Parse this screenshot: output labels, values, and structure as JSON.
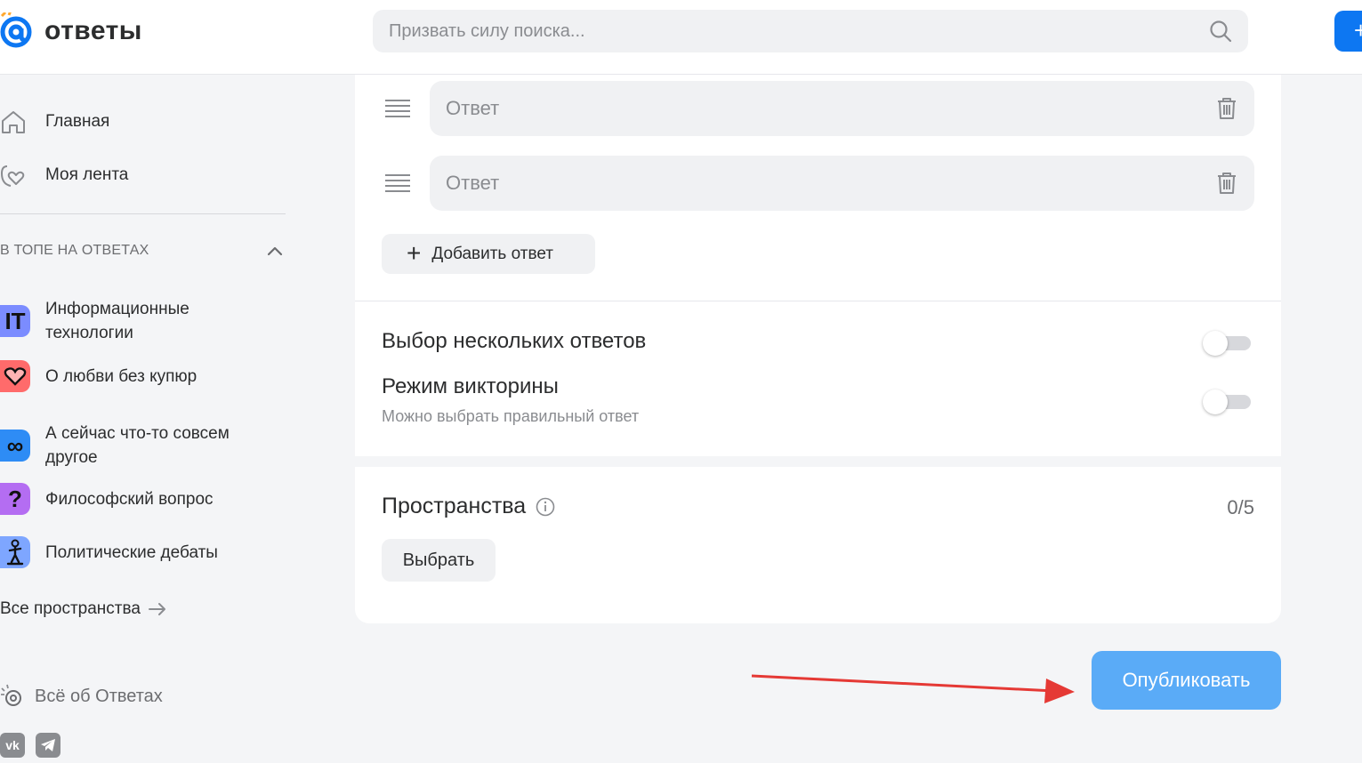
{
  "header": {
    "logo_text": "ответы",
    "search_placeholder": "Призвать силу поиска...",
    "header_button_label": "+"
  },
  "sidebar": {
    "nav": [
      {
        "label": "Главная",
        "icon": "home-icon"
      },
      {
        "label": "Моя лента",
        "icon": "feed-heart-icon"
      }
    ],
    "section_title": "В ТОПЕ НА ОТВЕТАХ",
    "topics": [
      {
        "label": "Информационные технологии",
        "badge": "IT",
        "color": "#7b8cff"
      },
      {
        "label": "О любви без купюр",
        "badge": "♡",
        "color": "#ff6b6b"
      },
      {
        "label": "А сейчас что-то совсем другое",
        "badge": "∞",
        "color": "#2e8cf5"
      },
      {
        "label": "Философский вопрос",
        "badge": "?",
        "color": "#b46df2"
      },
      {
        "label": "Политические дебаты",
        "badge": "🎤",
        "color": "#7ea6ff"
      }
    ],
    "all_spaces": "Все пространства",
    "about": "Всё об Ответах",
    "social": [
      {
        "icon": "vk-icon",
        "label": "vk"
      },
      {
        "icon": "telegram-icon",
        "label": "tg"
      }
    ]
  },
  "poll": {
    "answers": [
      {
        "placeholder": "Ответ",
        "value": ""
      },
      {
        "placeholder": "Ответ",
        "value": ""
      }
    ],
    "add_answer": "Добавить ответ",
    "multiple_choice": {
      "title": "Выбор нескольких ответов",
      "enabled": false
    },
    "quiz_mode": {
      "title": "Режим викторины",
      "subtitle": "Можно выбрать правильный ответ",
      "enabled": false
    }
  },
  "spaces": {
    "title": "Пространства",
    "count": "0/5",
    "choose_button": "Выбрать"
  },
  "publish_button": "Опубликовать",
  "colors": {
    "brand_blue": "#0d77f2",
    "publish_blue": "#5aabf7",
    "annotation_arrow": "#e53935",
    "logo_orange": "#ffa930"
  }
}
